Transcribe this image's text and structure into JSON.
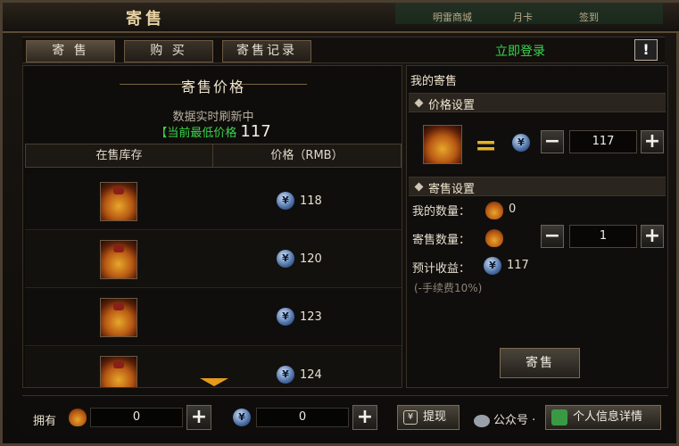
{
  "window": {
    "title": "寄售"
  },
  "top_strip": {
    "items": [
      "明雷商城",
      "月卡",
      "签到"
    ]
  },
  "tabs": [
    {
      "label": "寄 售",
      "active": true
    },
    {
      "label": "购 买",
      "active": false
    },
    {
      "label": "寄售记录",
      "active": false
    }
  ],
  "login_link": "立即登录",
  "help_label": "!",
  "left": {
    "title": "寄售价格",
    "subtitle": "数据实时刷新中",
    "lowest_label": "【当前最低价格",
    "lowest_value": "117",
    "columns": [
      "在售库存",
      "价格（RMB）"
    ],
    "rows": [
      {
        "item_icon": "gold-bag-icon",
        "price": "118"
      },
      {
        "item_icon": "gold-bag-icon",
        "price": "120"
      },
      {
        "item_icon": "gold-bag-icon",
        "price": "123"
      },
      {
        "item_icon": "gold-bag-icon",
        "price": "124"
      }
    ]
  },
  "right": {
    "header": "我的寄售",
    "price_section": "价格设置",
    "equals": "=",
    "price_value": "117",
    "sell_section": "寄售设置",
    "my_qty_label": "我的数量：",
    "my_qty_value": "0",
    "sell_qty_label": "寄售数量：",
    "sell_qty_value": "1",
    "expected_label": "预计收益：",
    "expected_value": "117",
    "fee_note": "(-手续费10%)",
    "sell_button": "寄售"
  },
  "bottom": {
    "own_label": "拥有",
    "bag_amount": "0",
    "coin_amount": "0",
    "withdraw_button": "提现",
    "watermark": "公众号 ·",
    "detail_button": "个人信息详情"
  },
  "colors": {
    "accent_green": "#34d94b",
    "gold": "#e5b323",
    "panel_bg": "#100e0c"
  }
}
